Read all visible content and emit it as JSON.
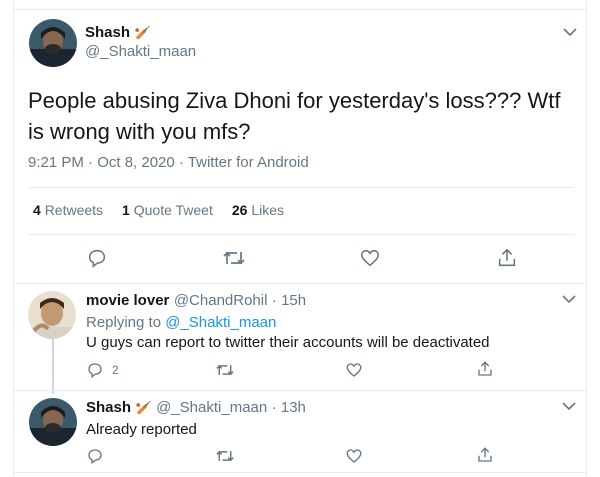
{
  "main_tweet": {
    "author_name": "Shash",
    "author_emoji": "🏏",
    "author_handle": "@_Shakti_maan",
    "text": "People abusing Ziva Dhoni for yesterday's loss??? Wtf is wrong with you mfs?",
    "meta": "9:21 PM · Oct 8, 2020 · Twitter for Android",
    "stats": {
      "retweets_count": "4",
      "retweets_label": "Retweets",
      "quote_count": "1",
      "quote_label": "Quote Tweet",
      "likes_count": "26",
      "likes_label": "Likes"
    },
    "actions": [
      "reply-icon",
      "retweet-icon",
      "like-icon",
      "share-icon"
    ]
  },
  "replies": [
    {
      "author_name": "movie lover",
      "author_handle": "@ChandRohil",
      "time": "· 15h",
      "replying_prefix": "Replying to",
      "replying_to": "@_Shakti_maan",
      "text": "U guys can report to twitter their accounts will be deactivated",
      "reply_count": "2"
    },
    {
      "author_name": "Shash",
      "author_emoji": "🏏",
      "author_handle": "@_Shakti_maan",
      "time": "· 13h",
      "text": "Already reported"
    }
  ],
  "colors": {
    "text": "#14171a",
    "secondary": "#657786",
    "link": "#1b95e0",
    "border": "#e6ecf0"
  }
}
